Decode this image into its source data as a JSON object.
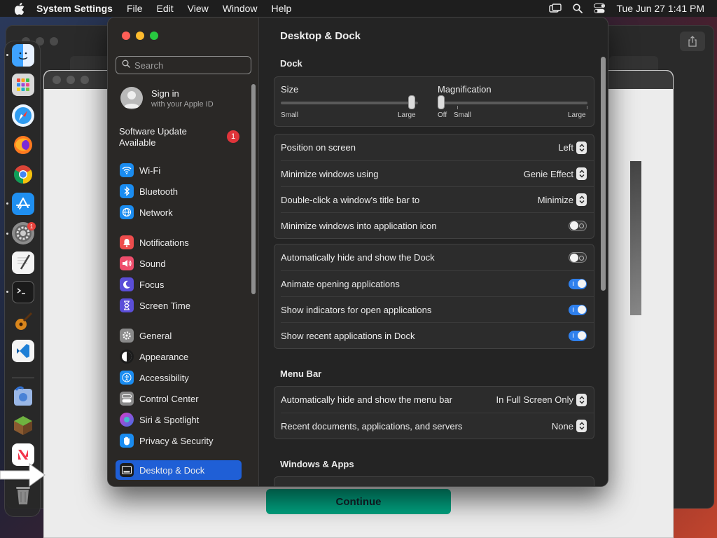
{
  "menubar": {
    "app_name": "System Settings",
    "items": [
      "File",
      "Edit",
      "View",
      "Window",
      "Help"
    ],
    "datetime": "Tue Jun 27  1:41 PM"
  },
  "installer": {
    "continue_label": "Continue"
  },
  "sidebar": {
    "search_placeholder": "Search",
    "signin_title": "Sign in",
    "signin_sub": "with your Apple ID",
    "update_text": "Software Update Available",
    "update_badge": "1",
    "items": [
      {
        "label": "Wi-Fi",
        "icon": "wifi-icon",
        "color": "#1a8cf0"
      },
      {
        "label": "Bluetooth",
        "icon": "bluetooth-icon",
        "color": "#1a8cf0"
      },
      {
        "label": "Network",
        "icon": "globe-icon",
        "color": "#1a8cf0"
      },
      {
        "label": "Notifications",
        "icon": "bell-icon",
        "color": "#ee4d4d"
      },
      {
        "label": "Sound",
        "icon": "speaker-icon",
        "color": "#ee4d6b"
      },
      {
        "label": "Focus",
        "icon": "moon-icon",
        "color": "#5b4ed8"
      },
      {
        "label": "Screen Time",
        "icon": "hourglass-icon",
        "color": "#5b4ed8"
      },
      {
        "label": "General",
        "icon": "gear-icon",
        "color": "#8a8a8a"
      },
      {
        "label": "Appearance",
        "icon": "appearance-icon",
        "color": "#1c1c1c"
      },
      {
        "label": "Accessibility",
        "icon": "accessibility-icon",
        "color": "#1a8cf0"
      },
      {
        "label": "Control Center",
        "icon": "control-center-icon",
        "color": "#8a8a8a"
      },
      {
        "label": "Siri & Spotlight",
        "icon": "siri-icon",
        "color": "#9a40c8"
      },
      {
        "label": "Privacy & Security",
        "icon": "hand-icon",
        "color": "#1a8cf0"
      },
      {
        "label": "Desktop & Dock",
        "icon": "dock-icon",
        "color": "#1c1c1c"
      }
    ]
  },
  "content": {
    "title": "Desktop & Dock",
    "dock_section": "Dock",
    "size_label": "Size",
    "size_min": "Small",
    "size_max": "Large",
    "size_value": 0.98,
    "mag_label": "Magnification",
    "mag_off": "Off",
    "mag_min": "Small",
    "mag_max": "Large",
    "mag_value": 0.0,
    "rows1": [
      {
        "label": "Position on screen",
        "value": "Left"
      },
      {
        "label": "Minimize windows using",
        "value": "Genie Effect"
      },
      {
        "label": "Double-click a window's title bar to",
        "value": "Minimize"
      },
      {
        "label": "Minimize windows into application icon",
        "toggle": false
      }
    ],
    "rows2": [
      {
        "label": "Automatically hide and show the Dock",
        "toggle": false
      },
      {
        "label": "Animate opening applications",
        "toggle": true
      },
      {
        "label": "Show indicators for open applications",
        "toggle": true
      },
      {
        "label": "Show recent applications in Dock",
        "toggle": true
      }
    ],
    "menubar_section": "Menu Bar",
    "rows3": [
      {
        "label": "Automatically hide and show the menu bar",
        "value": "In Full Screen Only"
      },
      {
        "label": "Recent documents, applications, and servers",
        "value": "None"
      }
    ],
    "windows_section": "Windows & Apps"
  },
  "dock": {
    "apps": [
      {
        "name": "finder-icon",
        "color": "#3d8af7"
      },
      {
        "name": "launchpad-icon",
        "color": "#d8d8d8"
      },
      {
        "name": "safari-icon",
        "color": "#2e9bf0"
      },
      {
        "name": "firefox-icon",
        "color": "#ff7a1f"
      },
      {
        "name": "chrome-icon",
        "color": "#f2f2f2"
      },
      {
        "name": "app-store-icon",
        "color": "#1f8ff0"
      },
      {
        "name": "system-settings-icon",
        "color": "#8c8c8c"
      },
      {
        "name": "textedit-icon",
        "color": "#f4f4f4"
      },
      {
        "name": "terminal-icon",
        "color": "#1a1a1a"
      },
      {
        "name": "garageband-icon",
        "color": "#f0a020"
      },
      {
        "name": "vscode-icon",
        "color": "#1e7fd6"
      },
      {
        "name": "migration-icon",
        "color": "#5a8ad8"
      },
      {
        "name": "minecraft-icon",
        "color": "#5b8c3a"
      },
      {
        "name": "news-icon",
        "color": "#f2f2f2"
      },
      {
        "name": "trash-icon",
        "color": "#6a6a6a"
      }
    ],
    "settings_badge": "1"
  }
}
